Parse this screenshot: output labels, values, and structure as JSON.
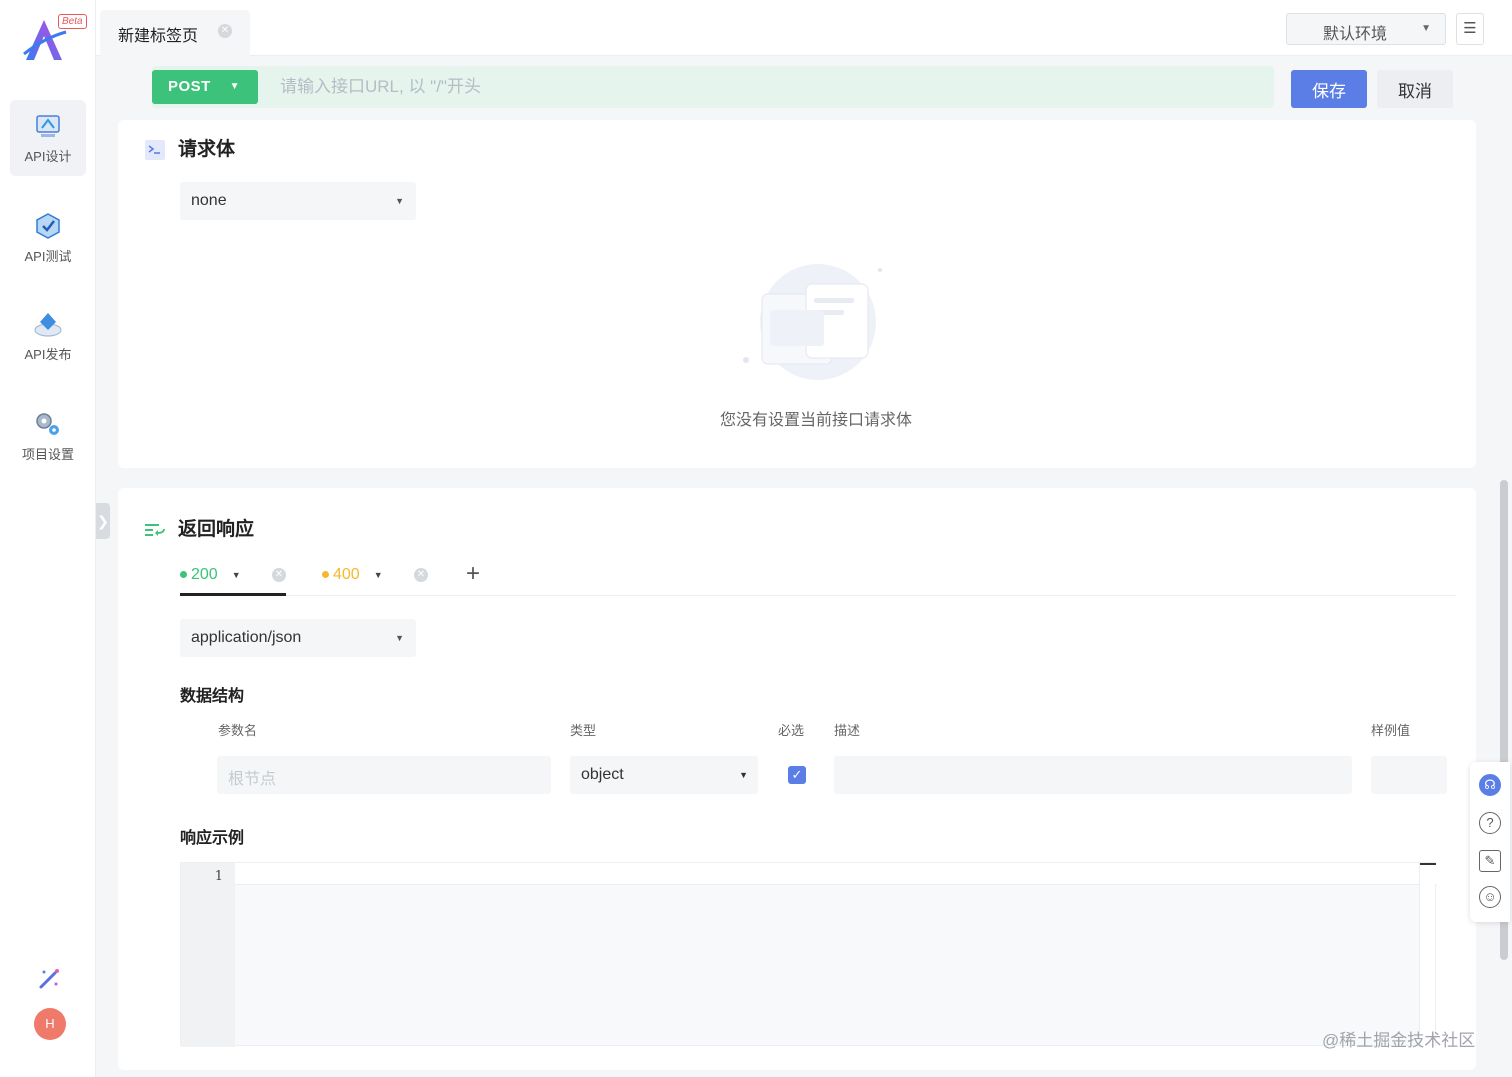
{
  "sidebar": {
    "logo_badge": "Beta",
    "items": [
      {
        "label": "API设计",
        "icon": "api-design-icon"
      },
      {
        "label": "API测试",
        "icon": "api-test-icon"
      },
      {
        "label": "API发布",
        "icon": "api-publish-icon"
      },
      {
        "label": "项目设置",
        "icon": "project-settings-icon"
      }
    ],
    "avatar": "H"
  },
  "header": {
    "tab_title": "新建标签页",
    "environment": "默认环境"
  },
  "url_bar": {
    "method": "POST",
    "url_placeholder": "请输入接口URL, 以 \"/\"开头",
    "save_label": "保存",
    "cancel_label": "取消"
  },
  "request_body": {
    "title": "请求体",
    "type": "none",
    "empty_text": "您没有设置当前接口请求体"
  },
  "response": {
    "title": "返回响应",
    "statuses": [
      {
        "code": "200",
        "color": "#3cc27a"
      },
      {
        "code": "400",
        "color": "#f5b82e"
      }
    ],
    "content_type": "application/json",
    "schema_title": "数据结构",
    "columns": {
      "name": "参数名",
      "type": "类型",
      "required": "必选",
      "description": "描述",
      "example": "样例值"
    },
    "root_row": {
      "name_placeholder": "根节点",
      "type": "object",
      "required": true
    },
    "example_title": "响应示例",
    "editor_line": "1"
  },
  "colors": {
    "accent": "#5b7ee6",
    "method_post": "#3cc27a",
    "url_bg": "#e5f4ec"
  },
  "watermark": "@稀土掘金技术社区"
}
